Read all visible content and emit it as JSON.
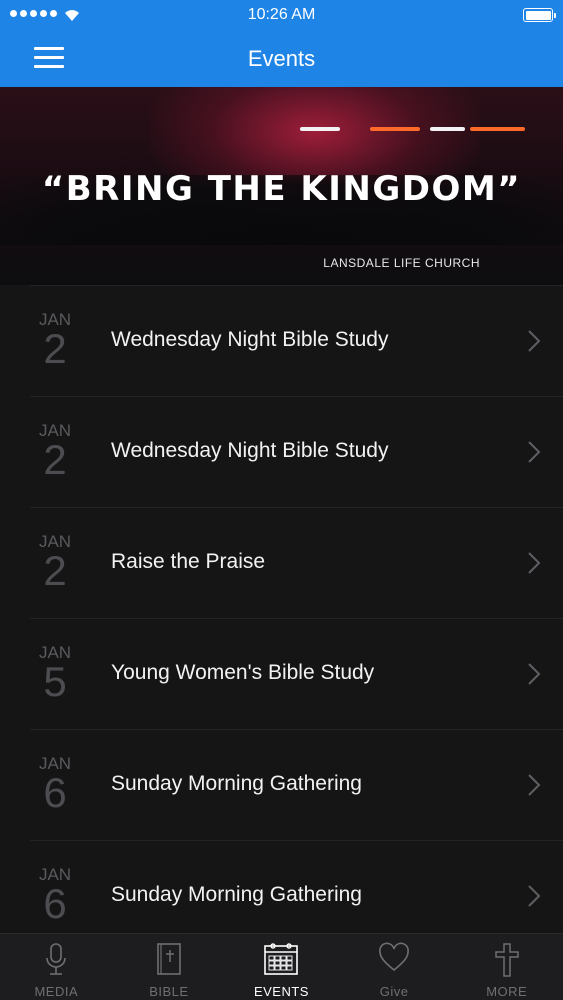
{
  "status_bar": {
    "time": "10:26 AM"
  },
  "header": {
    "title": "Events",
    "menu_icon": "hamburger-menu-icon"
  },
  "banner": {
    "title": "“BRING THE KINGDOM”",
    "subtitle": "LANSDALE LIFE CHURCH"
  },
  "events": [
    {
      "month": "JAN",
      "day": "2",
      "title": "Wednesday Night Bible Study"
    },
    {
      "month": "JAN",
      "day": "2",
      "title": "Wednesday Night Bible Study"
    },
    {
      "month": "JAN",
      "day": "2",
      "title": "Raise the Praise"
    },
    {
      "month": "JAN",
      "day": "5",
      "title": "Young Women's Bible Study"
    },
    {
      "month": "JAN",
      "day": "6",
      "title": "Sunday Morning Gathering"
    },
    {
      "month": "JAN",
      "day": "6",
      "title": "Sunday Morning Gathering"
    }
  ],
  "tabs": [
    {
      "label": "MEDIA",
      "icon": "microphone-icon"
    },
    {
      "label": "BIBLE",
      "icon": "bible-icon"
    },
    {
      "label": "EVENTS",
      "icon": "calendar-icon",
      "active": true
    },
    {
      "label": "Give",
      "icon": "heart-icon"
    },
    {
      "label": "MORE",
      "icon": "cross-icon"
    }
  ],
  "colors": {
    "accent": "#1e84e6",
    "background": "#151516",
    "tab_bar": "#1d1d1f"
  }
}
